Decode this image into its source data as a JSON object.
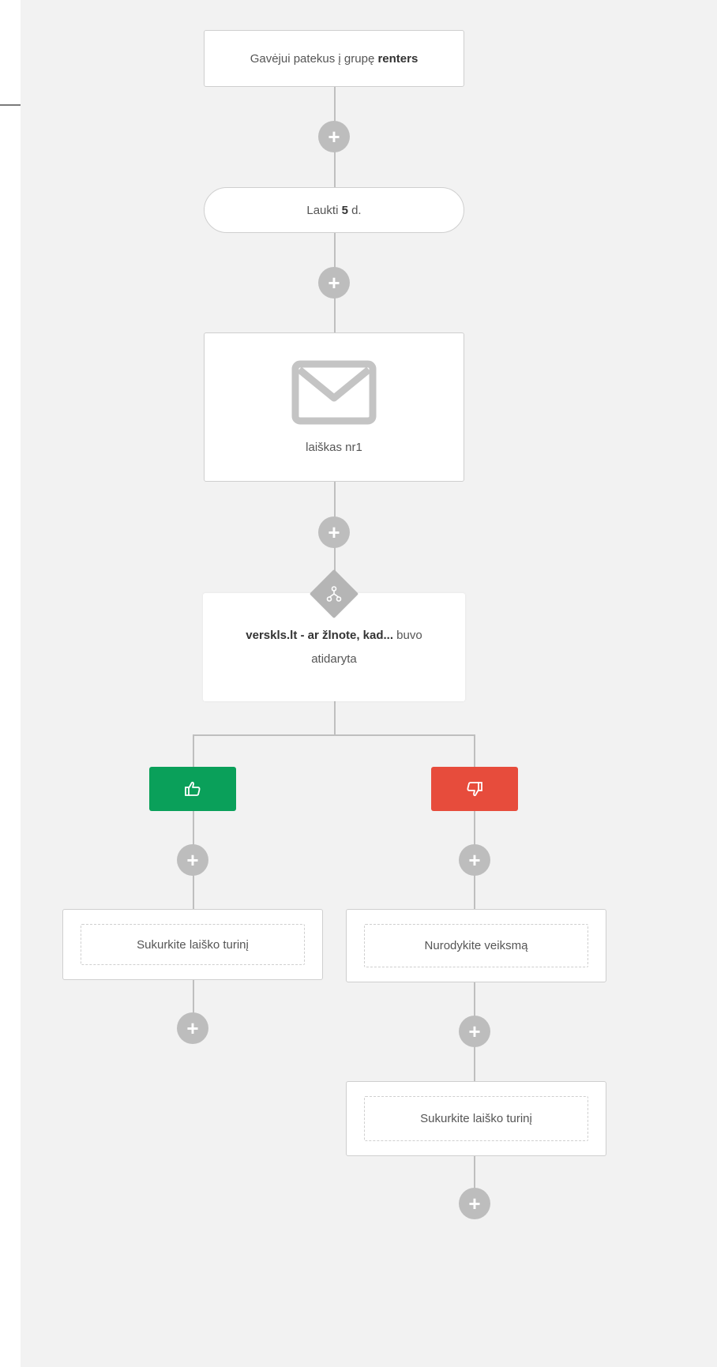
{
  "trigger": {
    "prefix": "Gavėjui patekus į grupę ",
    "group": "renters"
  },
  "wait": {
    "prefix": "Laukti ",
    "days": "5",
    "suffix": " d."
  },
  "email": {
    "icon": "envelope-icon",
    "label": "laiškas nr1"
  },
  "condition": {
    "icon": "branch-icon",
    "subject": "verskls.lt - ar žlnote, kad...",
    "status_suffix": " buvo",
    "status_line2": "atidaryta"
  },
  "branches": {
    "yes": {
      "icon": "thumbs-up-icon",
      "color": "#0aa05a",
      "step1": "Sukurkite laiško turinį"
    },
    "no": {
      "icon": "thumbs-down-icon",
      "color": "#e74c3c",
      "step1": "Nurodykite veiksmą",
      "step2": "Sukurkite laiško turinį"
    }
  },
  "add_step_symbol": "+"
}
